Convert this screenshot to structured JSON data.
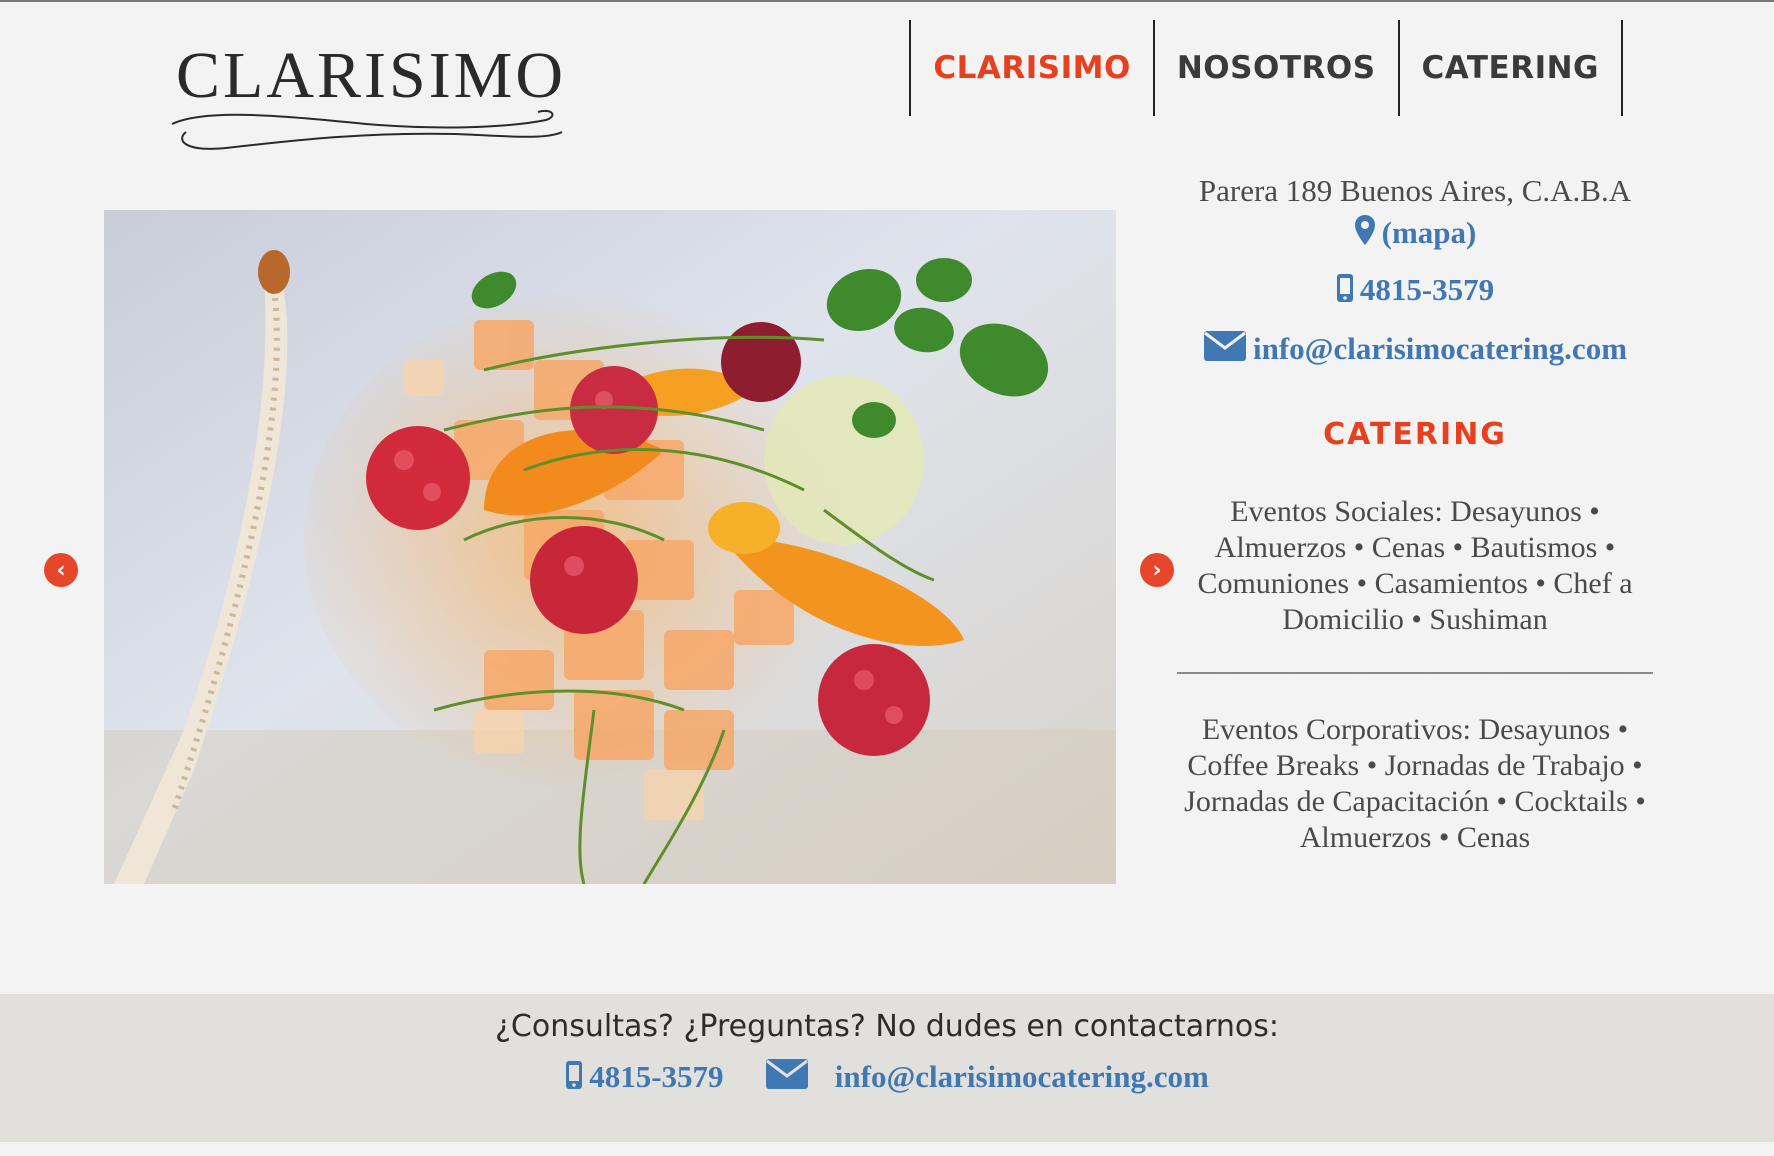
{
  "brand": {
    "logo_text": "CLARISIMO"
  },
  "nav": {
    "items": [
      {
        "label": "CLARISIMO",
        "active": true
      },
      {
        "label": "NOSOTROS",
        "active": false
      },
      {
        "label": "CATERING",
        "active": false
      }
    ]
  },
  "slider": {
    "prev_icon": "chevron-left-icon",
    "next_icon": "chevron-right-icon",
    "image_subject": "plated dessert with orange jelly cubes, raspberries, orange segments, mint and coconut"
  },
  "contact": {
    "address": "Parera 189 Buenos Aires, C.A.B.A",
    "map_label": "(mapa)",
    "phone": "4815-3579",
    "email": "info@clarisimocatering.com"
  },
  "catering": {
    "title": "CATERING",
    "social": "Eventos Sociales: Desayunos • Almuerzos • Cenas • Bautismos • Comuniones • Casamientos • Chef a Domicilio • Sushiman",
    "corporate": "Eventos Corporativos: Desayunos • Coffee Breaks • Jornadas de Trabajo • Jornadas de Capacitación • Cocktails • Almuerzos • Cenas"
  },
  "footer": {
    "title": "¿Consultas? ¿Preguntas? No dudes en contactarnos:",
    "phone": "4815-3579",
    "email": "info@clarisimocatering.com"
  },
  "colors": {
    "accent": "#e8401e",
    "link": "#3f78b2",
    "footer_bg": "#e2e0dc",
    "page_bg": "#f3f3f3"
  }
}
